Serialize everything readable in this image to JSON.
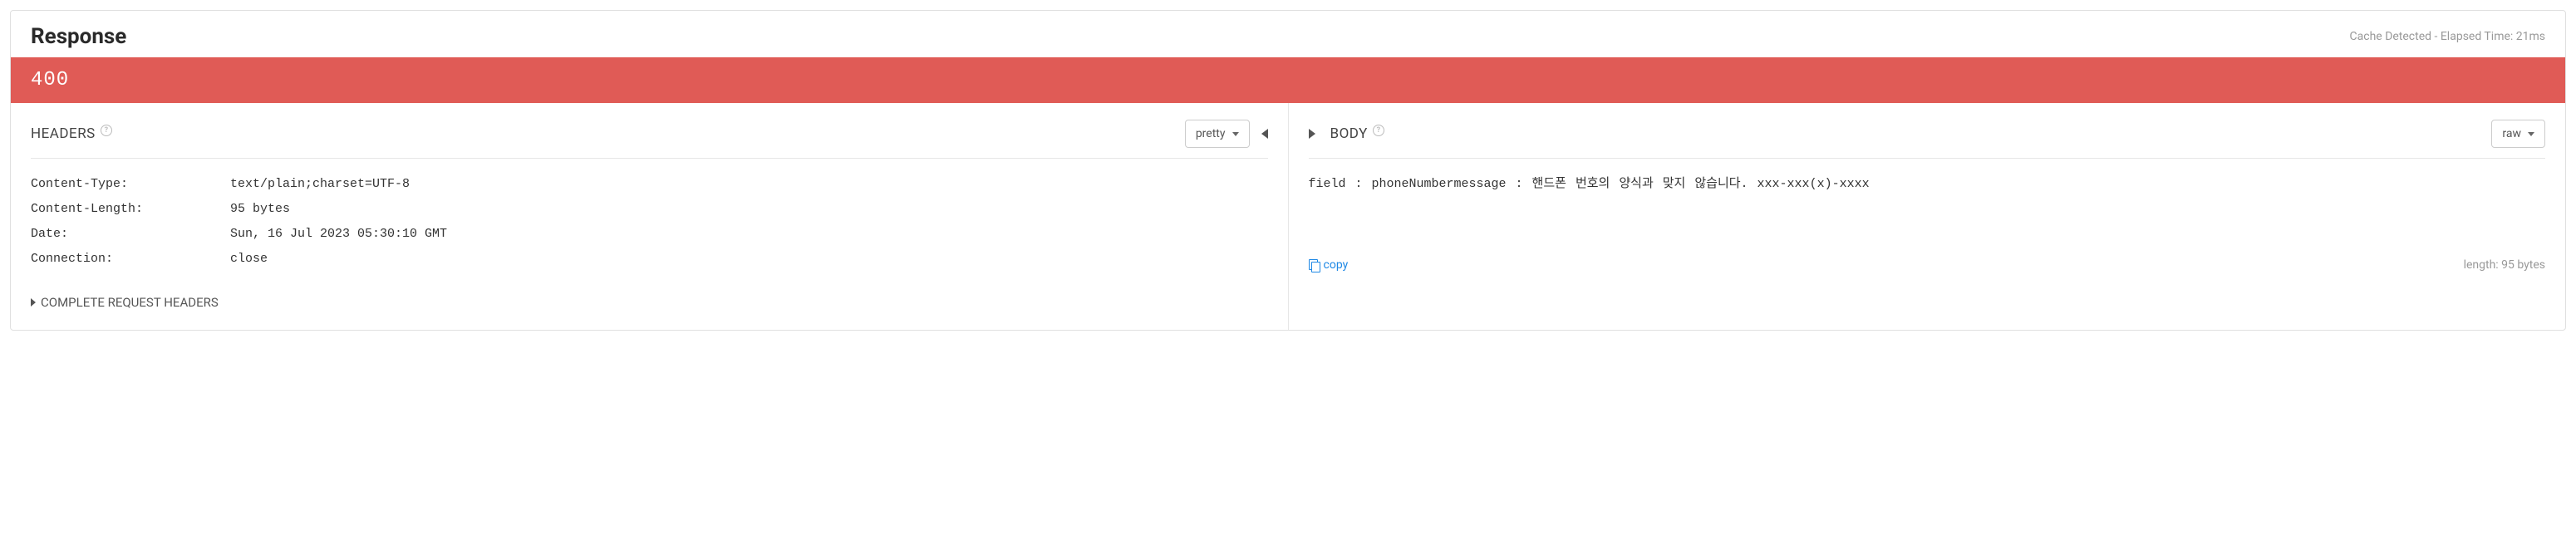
{
  "header": {
    "title": "Response",
    "meta": "Cache Detected  -  Elapsed Time: 21ms"
  },
  "status": {
    "code": "400"
  },
  "headers_section": {
    "title": "HEADERS",
    "format": "pretty",
    "items": [
      {
        "key": "Content-Type:",
        "value": "text/plain;charset=UTF-8"
      },
      {
        "key": "Content-Length:",
        "value": "95 bytes"
      },
      {
        "key": "Date:",
        "value": "Sun, 16 Jul 2023 05:30:10 GMT"
      },
      {
        "key": "Connection:",
        "value": "close"
      }
    ],
    "collapsible_label": "COMPLETE REQUEST HEADERS"
  },
  "body_section": {
    "title": "BODY",
    "format": "raw",
    "content": "field : phoneNumbermessage : 핸드폰 번호의 양식과 맞지 않습니다. xxx-xxx(x)-xxxx",
    "copy_label": "copy",
    "length_label": "length: 95 bytes"
  }
}
